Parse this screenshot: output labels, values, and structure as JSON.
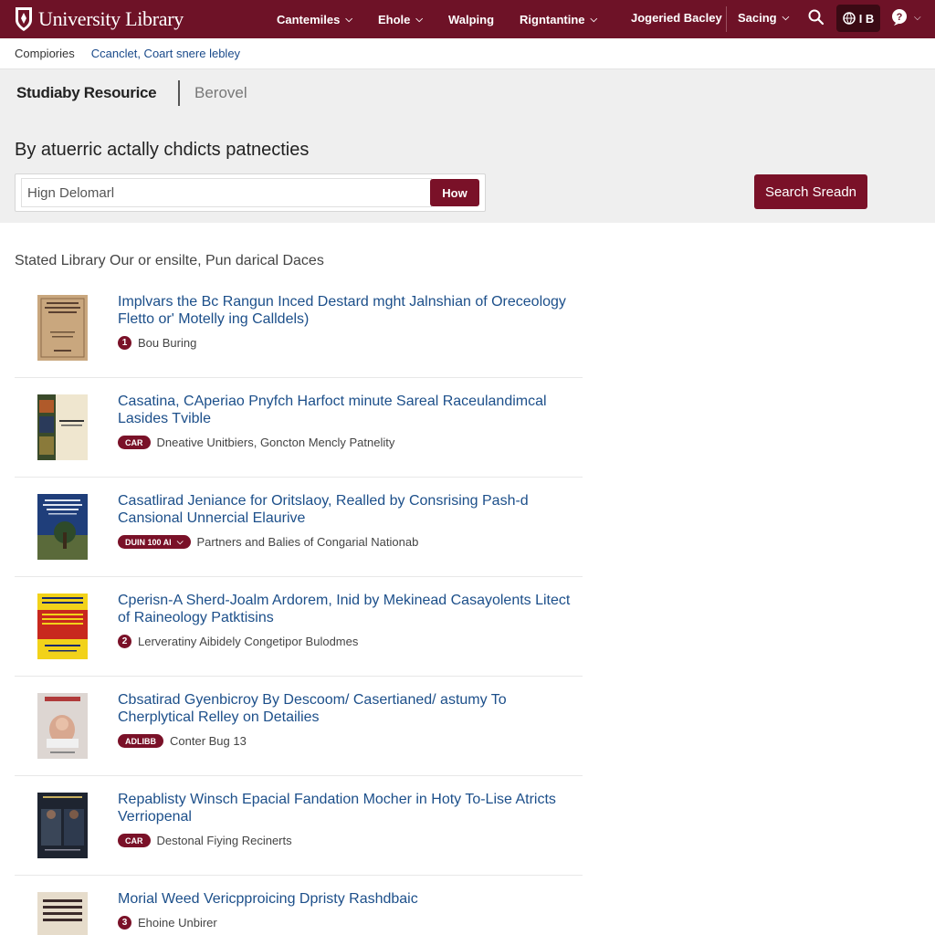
{
  "header": {
    "brand": "University Library",
    "nav": [
      {
        "label": "Cantemiles",
        "dropdown": true
      },
      {
        "label": "Ehole",
        "dropdown": true
      },
      {
        "label": "Walping",
        "dropdown": false
      },
      {
        "label": "Rigntantine",
        "dropdown": true
      }
    ],
    "login_label": "Jogeried Bacley",
    "settings_label": "Sacing",
    "user_label": "I B"
  },
  "breadcrumb": {
    "root": "Compiories",
    "link": "Ccanclet,  Coart snere lebley"
  },
  "hero": {
    "tab_active": "Studiaby Resourice",
    "tab_other": "Berovel",
    "heading": "By atuerric actally chdicts patnecties",
    "search_value": "Hign Delomarl",
    "how_button": "How",
    "search_button": "Search Sreadn"
  },
  "results_label": "Stated Library Our or ensilte, Pun darical Daces",
  "results": [
    {
      "title": "Implvars the Bc Rangun Inced Destard mght Jalnshian of Oreceology Fletto or' Motelly ing Calldels)",
      "badge": "1",
      "badge_type": "num",
      "meta": "Bou Buring",
      "cover": "tan"
    },
    {
      "title": "Casatina, CAperiao Pnyfch Harfoct minute Sareal Raceulandimcal Lasides Tvible",
      "badge": "CAR",
      "badge_type": "pill",
      "meta": "Dneative Unitbiers, Goncton Mencly Patnelity",
      "cover": "collage"
    },
    {
      "title": "Casatlirad Jeniance for Oritslaoy, Realled by Consrising Pash-d Cansional Unnercial Elaurive",
      "badge": "DUIN 100 Al",
      "badge_type": "pill-chevron",
      "meta": "Partners and Balies of Congarial Nationab",
      "cover": "blue"
    },
    {
      "title": "Cperisn-A Sherd-Joalm Ardorem, Inid by Mekinead Casayolents Litect of Raineology Patktisins",
      "badge": "2",
      "badge_type": "num",
      "meta": "Lerveratiny Aibidely Congetipor Bulodmes",
      "cover": "yellow"
    },
    {
      "title": "Cbsatirad Gyenbicroy By Descoom/ Casertianed/ astumy To Cherplytical Relley on Detailies",
      "badge": "ADLIBB",
      "badge_type": "pill",
      "meta": "Conter Bug 13",
      "cover": "candy"
    },
    {
      "title": "Repablisty Winsch Epacial Fandation Mocher in Hoty To-Lise Atricts Verriopenal",
      "badge": "CAR",
      "badge_type": "pill",
      "meta": "Destonal Fiying Recinerts",
      "cover": "dark"
    },
    {
      "title": "Morial Weed Vericpproicing Dpristy Rashdbaic",
      "badge": "3",
      "badge_type": "num",
      "meta": "Ehoine Unbirer",
      "cover": "poster"
    }
  ],
  "colors": {
    "brand": "#6e1227",
    "accent": "#7a1128",
    "link": "#1c4f8a",
    "hero_bg": "#efefef"
  },
  "icons": [
    "crest-icon",
    "chevron-down-icon",
    "search-icon",
    "globe-icon",
    "help-icon"
  ]
}
